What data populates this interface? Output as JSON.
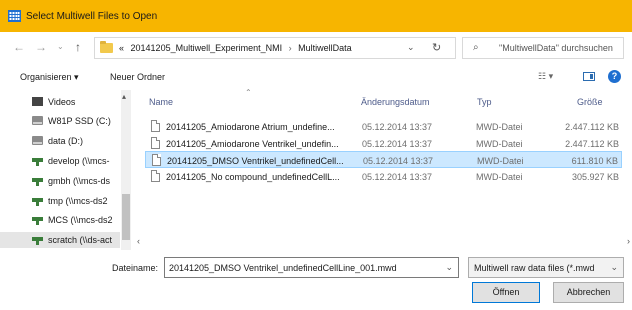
{
  "window": {
    "title": "Select Multiwell Files to Open"
  },
  "address": {
    "breadcrumb_prefix": "«",
    "crumbs": [
      "20141205_Multiwell_Experiment_NMI",
      "MultiwellData"
    ],
    "search_placeholder": "\"MultiwellData\" durchsuchen"
  },
  "toolbar": {
    "organize_label": "Organisieren ▾",
    "new_folder_label": "Neuer Ordner"
  },
  "nav": {
    "items": [
      {
        "label": "Videos",
        "icon": "video-folder-icon"
      },
      {
        "label": "W81P SSD (C:)",
        "icon": "drive-icon"
      },
      {
        "label": "data (D:)",
        "icon": "drive-icon"
      },
      {
        "label": "develop (\\\\mcs-",
        "icon": "network-drive-icon"
      },
      {
        "label": "gmbh (\\\\mcs-ds",
        "icon": "network-drive-icon"
      },
      {
        "label": "tmp (\\\\mcs-ds2",
        "icon": "network-drive-icon"
      },
      {
        "label": "MCS (\\\\mcs-ds2",
        "icon": "network-drive-icon"
      },
      {
        "label": "scratch (\\\\ds-act",
        "icon": "network-drive-icon"
      }
    ]
  },
  "list": {
    "columns": {
      "name": "Name",
      "date": "Änderungsdatum",
      "type": "Typ",
      "size": "Größe"
    },
    "files": [
      {
        "name": "20141205_Amiodarone Atrium_undefine...",
        "date": "05.12.2014 13:37",
        "type": "MWD-Datei",
        "size": "2.447.112 KB"
      },
      {
        "name": "20141205_Amiodarone Ventrikel_undefin...",
        "date": "05.12.2014 13:37",
        "type": "MWD-Datei",
        "size": "2.447.112 KB"
      },
      {
        "name": "20141205_DMSO Ventrikel_undefinedCell...",
        "date": "05.12.2014 13:37",
        "type": "MWD-Datei",
        "size": "611.810 KB"
      },
      {
        "name": "20141205_No compound_undefinedCellL...",
        "date": "05.12.2014 13:37",
        "type": "MWD-Datei",
        "size": "305.927 KB"
      }
    ]
  },
  "bottom": {
    "filename_label": "Dateiname:",
    "filename_value": "20141205_DMSO Ventrikel_undefinedCellLine_001.mwd",
    "filetype_value": "Multiwell raw data files (*.mwd",
    "open_label": "Öffnen",
    "cancel_label": "Abbrechen"
  },
  "colors": {
    "titlebar": "#f7b500",
    "selection": "#cce8ff",
    "accent": "#0078d7"
  }
}
